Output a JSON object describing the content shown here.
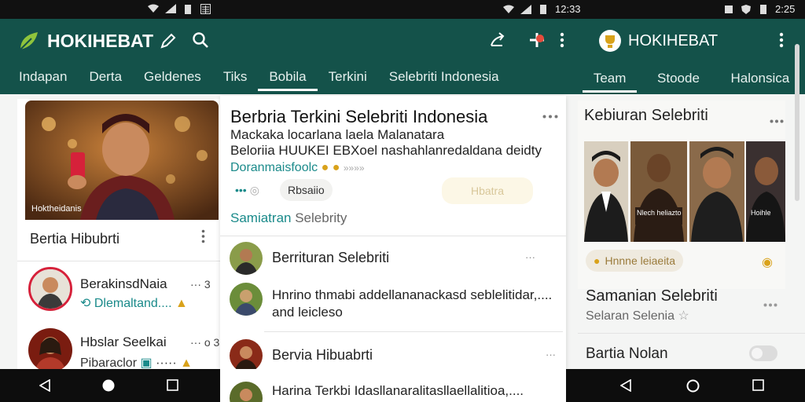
{
  "status": {
    "left_icons": [
      "wifi-icon",
      "signal-icon",
      "battery-icon",
      "calendar-icon"
    ],
    "mid_time": "12:33",
    "right_time": "2:25"
  },
  "left_app": {
    "brand": "HOKIHEBAT",
    "tabs": [
      "Indapan",
      "Derta",
      "Geldenes",
      "Tiks",
      "Bobila",
      "Terkini",
      "Selebriti Indonesia"
    ],
    "active_tab": 4,
    "hero_caption": "Hoktheidanis",
    "feed_title": "Bertia Hibubrti",
    "items": [
      {
        "name": "BerakinsdNaia",
        "meta": "··· 3",
        "sub": "Dlemaltand...."
      },
      {
        "name": "Hbslar Seelkai",
        "meta": "··· o 3",
        "sub": "Pibaraclor",
        "sub2": "·····"
      }
    ]
  },
  "middle_card": {
    "headline": "Berbria Terkini Selebriti Indonesia",
    "line1": "Mackaka locarlana laela Malanatara",
    "line2": "Beloriia HUUKEI EBXoel nashahlanredaldana deidty",
    "link_text": "Doranmaisfoolc",
    "link_tail": "»»»»",
    "chip_label": "Rbsaiio",
    "action_label": "Hbatra",
    "section_prefix": "Samiatran",
    "section_suffix": "Selebrity",
    "news": [
      {
        "title": "Berrituran Selebriti",
        "meta": "···"
      },
      {
        "title": "Hnrino thmabi addellananackasd seblelitidar,....",
        "title2": "and leicleso"
      },
      {
        "title": "Bervia Hibuabrti",
        "meta": "···"
      },
      {
        "title": "Harina Terkbi Idasllanaralitasllaellalitioa,...."
      }
    ]
  },
  "right_app": {
    "brand": "HOKIHEBAT",
    "tabs": [
      "Team",
      "Stoode",
      "Halonsica"
    ],
    "active_tab": 0,
    "section_title": "Kebiuran Selebriti",
    "thumbs": [
      "Nlech heliazto",
      "Hoihle"
    ],
    "chip_label": "Hnnne leiaeita",
    "list_title": "Samanian Selebriti",
    "list_sub": "Selaran Selenia",
    "bottom_title": "Bartia Nolan"
  },
  "colors": {
    "appbar": "#14524a",
    "accent": "#1a8a8a",
    "badge": "#d9a21b"
  }
}
